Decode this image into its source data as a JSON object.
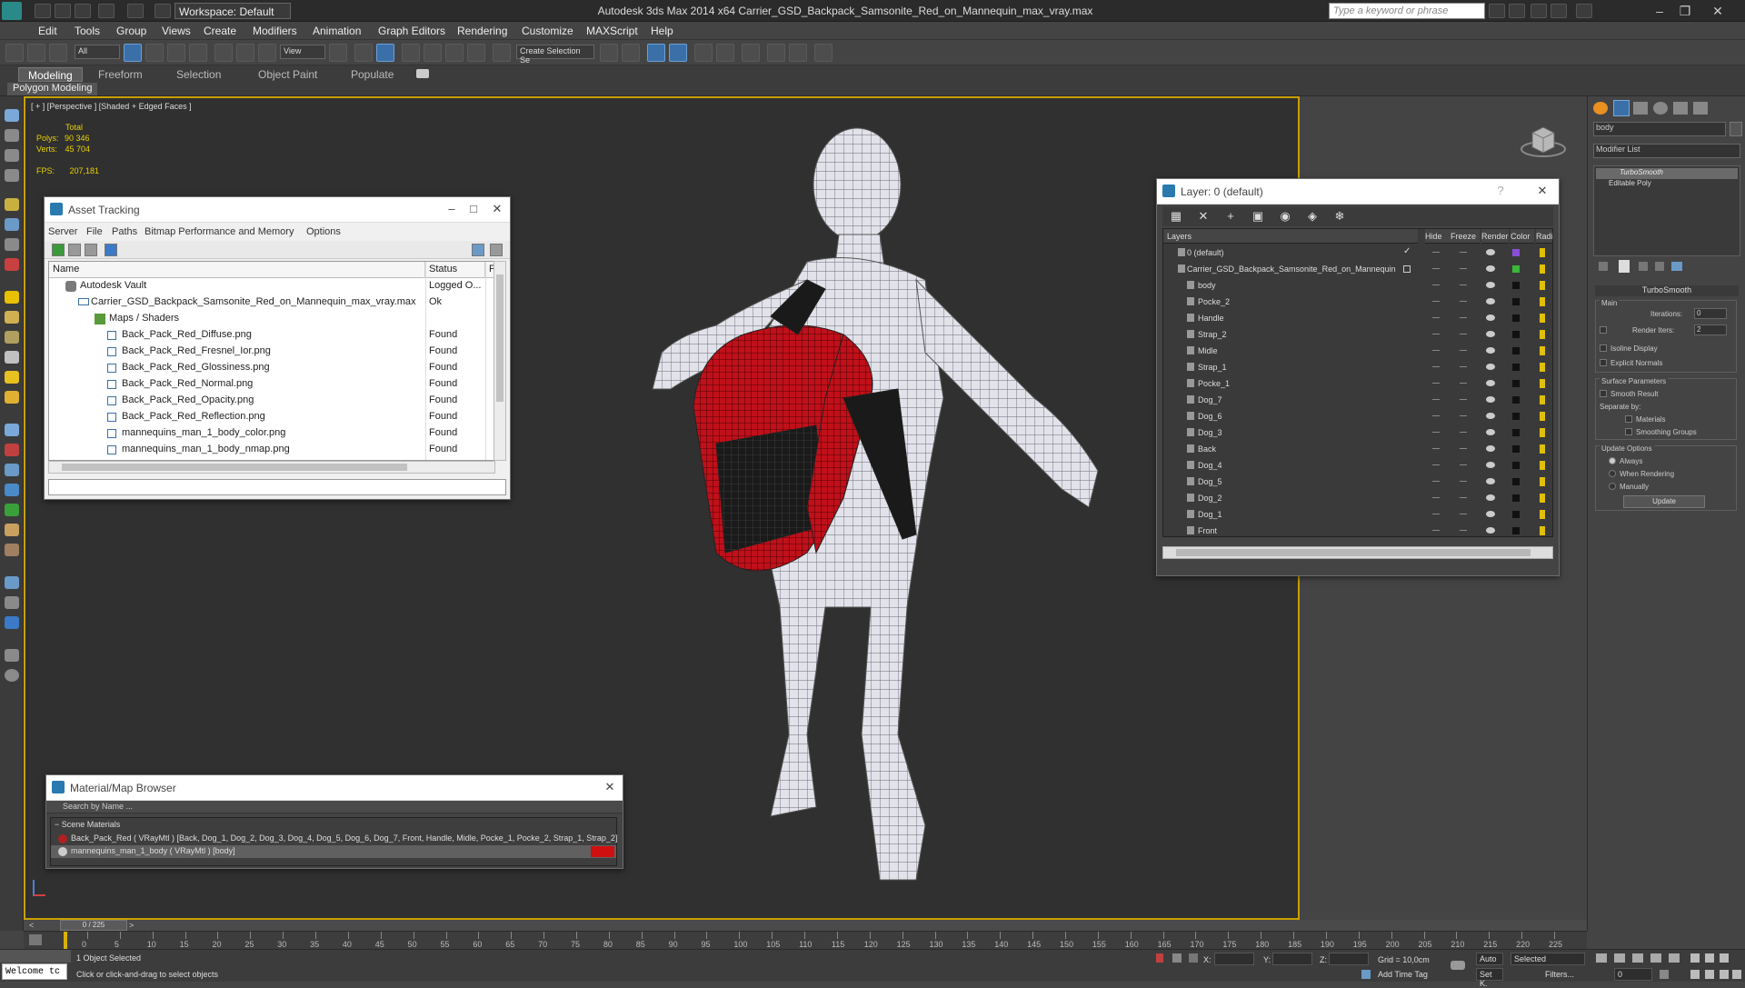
{
  "app": {
    "title": "Autodesk 3ds Max  2014 x64     Carrier_GSD_Backpack_Samsonite_Red_on_Mannequin_max_vray.max",
    "workspace": "Workspace: Default",
    "search_placeholder": "Type a keyword or phrase"
  },
  "menu": [
    "Edit",
    "Tools",
    "Group",
    "Views",
    "Create",
    "Modifiers",
    "Animation",
    "Graph Editors",
    "Rendering",
    "Customize",
    "MAXScript",
    "Help"
  ],
  "toolbar": {
    "filter": "All",
    "coord_system": "View",
    "selection_set": "Create Selection Se"
  },
  "ribbon": {
    "tabs": [
      "Modeling",
      "Freeform",
      "Selection",
      "Object Paint",
      "Populate"
    ],
    "active_tab": "Modeling",
    "panel_label": "Polygon Modeling"
  },
  "viewport": {
    "label": "[ + ] [Perspective ] [Shaded + Edged Faces ]",
    "stats_header": "Total",
    "polys_label": "Polys:",
    "polys_value": "90 346",
    "verts_label": "Verts:",
    "verts_value": "45 704",
    "fps_label": "FPS:",
    "fps_value": "207,181"
  },
  "asset_tracking": {
    "title": "Asset Tracking",
    "menu": [
      "Server",
      "File",
      "Paths",
      "Bitmap Performance and Memory",
      "Options"
    ],
    "columns": [
      "Name",
      "Status",
      "P"
    ],
    "rows": [
      {
        "name": "Autodesk Vault",
        "status": "Logged O...",
        "type": "vault",
        "indent": 0
      },
      {
        "name": "Carrier_GSD_Backpack_Samsonite_Red_on_Mannequin_max_vray.max",
        "status": "Ok",
        "type": "file",
        "indent": 1
      },
      {
        "name": "Maps / Shaders",
        "status": "",
        "type": "maps",
        "indent": 2
      },
      {
        "name": "Back_Pack_Red_Diffuse.png",
        "status": "Found",
        "type": "image",
        "indent": 3
      },
      {
        "name": "Back_Pack_Red_Fresnel_Ior.png",
        "status": "Found",
        "type": "image",
        "indent": 3
      },
      {
        "name": "Back_Pack_Red_Glossiness.png",
        "status": "Found",
        "type": "image",
        "indent": 3
      },
      {
        "name": "Back_Pack_Red_Normal.png",
        "status": "Found",
        "type": "image",
        "indent": 3
      },
      {
        "name": "Back_Pack_Red_Opacity.png",
        "status": "Found",
        "type": "image",
        "indent": 3
      },
      {
        "name": "Back_Pack_Red_Reflection.png",
        "status": "Found",
        "type": "image",
        "indent": 3
      },
      {
        "name": "mannequins_man_1_body_color.png",
        "status": "Found",
        "type": "image",
        "indent": 3
      },
      {
        "name": "mannequins_man_1_body_nmap.png",
        "status": "Found",
        "type": "image",
        "indent": 3
      }
    ]
  },
  "layer_window": {
    "title": "Layer: 0 (default)",
    "columns": [
      "Layers",
      "Hide",
      "Freeze",
      "Render",
      "Color",
      "Radio"
    ],
    "rows": [
      {
        "name": "0 (default)",
        "indent": 0,
        "color": "#8a4fd8",
        "check": true
      },
      {
        "name": "Carrier_GSD_Backpack_Samsonite_Red_on_Mannequin",
        "indent": 0,
        "color": "#3ab83a",
        "check": false
      },
      {
        "name": "body",
        "indent": 1,
        "color": "#111111"
      },
      {
        "name": "Pocke_2",
        "indent": 1,
        "color": "#111111"
      },
      {
        "name": "Handle",
        "indent": 1,
        "color": "#111111"
      },
      {
        "name": "Strap_2",
        "indent": 1,
        "color": "#111111"
      },
      {
        "name": "Midle",
        "indent": 1,
        "color": "#111111"
      },
      {
        "name": "Strap_1",
        "indent": 1,
        "color": "#111111"
      },
      {
        "name": "Pocke_1",
        "indent": 1,
        "color": "#111111"
      },
      {
        "name": "Dog_7",
        "indent": 1,
        "color": "#111111"
      },
      {
        "name": "Dog_6",
        "indent": 1,
        "color": "#111111"
      },
      {
        "name": "Dog_3",
        "indent": 1,
        "color": "#111111"
      },
      {
        "name": "Back",
        "indent": 1,
        "color": "#111111"
      },
      {
        "name": "Dog_4",
        "indent": 1,
        "color": "#111111"
      },
      {
        "name": "Dog_5",
        "indent": 1,
        "color": "#111111"
      },
      {
        "name": "Dog_2",
        "indent": 1,
        "color": "#111111"
      },
      {
        "name": "Dog_1",
        "indent": 1,
        "color": "#111111"
      },
      {
        "name": "Front",
        "indent": 1,
        "color": "#111111"
      }
    ]
  },
  "material_browser": {
    "title": "Material/Map Browser",
    "search_placeholder": "Search by Name ...",
    "section": "Scene Materials",
    "items": [
      "Back_Pack_Red  ( VRayMtl ) [Back, Dog_1, Dog_2, Dog_3, Dog_4, Dog_5, Dog_6, Dog_7, Front, Handle, Midle, Pocke_1, Pocke_2, Strap_1, Strap_2]",
      "mannequins_man_1_body  ( VRayMtl ) [body]"
    ]
  },
  "command_panel": {
    "object_name": "body",
    "modifier_list": "Modifier List",
    "stack": [
      "TurboSmooth",
      "Editable Poly"
    ],
    "turbosmooth_title": "TurboSmooth",
    "main_label": "Main",
    "iterations_label": "Iterations:",
    "iterations_value": "0",
    "render_iters_label": "Render Iters:",
    "render_iters_value": "2",
    "isoline": "Isoline Display",
    "explicit_normals": "Explicit Normals",
    "surface_params": "Surface Parameters",
    "smooth_result": "Smooth Result",
    "separate_by": "Separate by:",
    "materials": "Materials",
    "smoothing_groups": "Smoothing Groups",
    "update_options": "Update Options",
    "always": "Always",
    "when_rendering": "When Rendering",
    "manually": "Manually",
    "update_button": "Update"
  },
  "timeline": {
    "frame_display": "0 / 225",
    "ticks": [
      "0",
      "5",
      "10",
      "15",
      "20",
      "25",
      "30",
      "35",
      "40",
      "45",
      "50",
      "55",
      "60",
      "65",
      "70",
      "75",
      "80",
      "85",
      "90",
      "95",
      "100",
      "105",
      "110",
      "115",
      "120",
      "125",
      "130",
      "135",
      "140",
      "145",
      "150",
      "155",
      "160",
      "165",
      "170",
      "175",
      "180",
      "185",
      "190",
      "195",
      "200",
      "205",
      "210",
      "215",
      "220",
      "225"
    ]
  },
  "status": {
    "maxscript": "Welcome tc",
    "selection": "1 Object Selected",
    "prompt": "Click or click-and-drag to select objects",
    "x_label": "X:",
    "y_label": "Y:",
    "z_label": "Z:",
    "grid": "Grid = 10,0cm",
    "add_time_tag": "Add Time Tag",
    "auto": "Auto",
    "set_key": "Set K.",
    "selected": "Selected",
    "filters": "Filters...",
    "frame": "0"
  }
}
